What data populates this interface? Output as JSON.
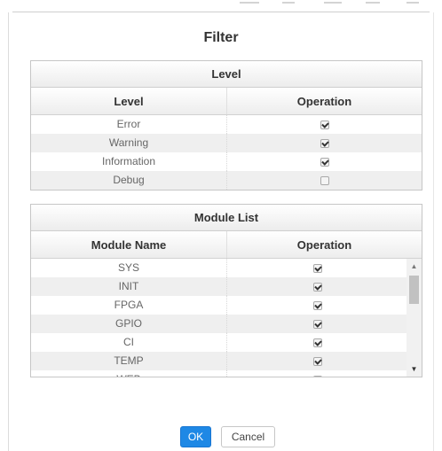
{
  "dialog": {
    "title": "Filter"
  },
  "level_panel": {
    "title": "Level",
    "columns": [
      "Level",
      "Operation"
    ],
    "rows": [
      {
        "name": "Error",
        "checked": true
      },
      {
        "name": "Warning",
        "checked": true
      },
      {
        "name": "Information",
        "checked": true
      },
      {
        "name": "Debug",
        "checked": false
      }
    ]
  },
  "module_panel": {
    "title": "Module List",
    "columns": [
      "Module Name",
      "Operation"
    ],
    "rows": [
      {
        "name": "SYS",
        "checked": true
      },
      {
        "name": "INIT",
        "checked": true
      },
      {
        "name": "FPGA",
        "checked": true
      },
      {
        "name": "GPIO",
        "checked": true
      },
      {
        "name": "CI",
        "checked": true
      },
      {
        "name": "TEMP",
        "checked": true
      },
      {
        "name": "WEB",
        "checked": true
      }
    ]
  },
  "buttons": {
    "ok": "OK",
    "cancel": "Cancel"
  },
  "colors": {
    "ok_button": "#1e88e5",
    "stripe": "#efefef"
  }
}
